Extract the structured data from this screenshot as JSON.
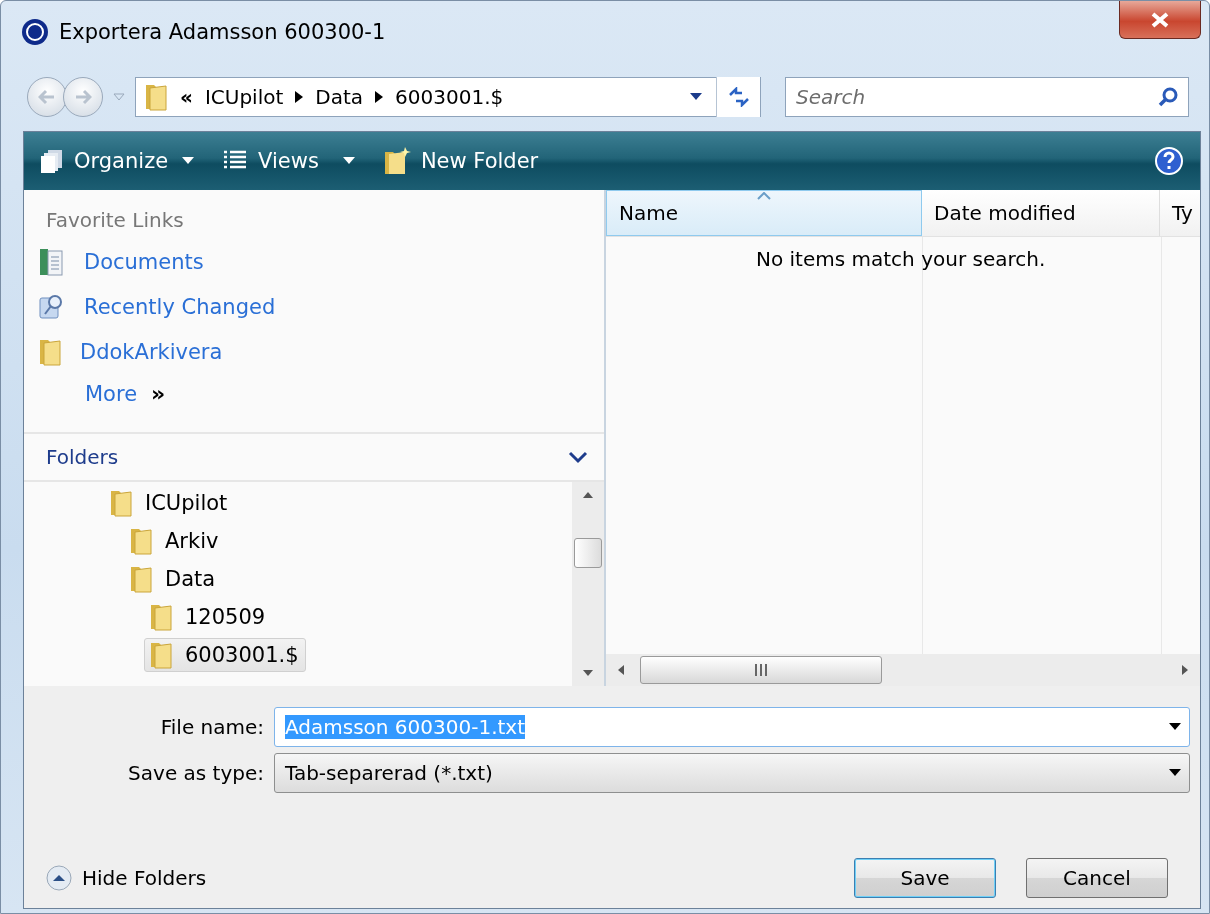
{
  "window": {
    "title": "Exportera Adamsson 600300-1"
  },
  "address": {
    "overflow": "«",
    "crumbs": [
      "ICUpilot",
      "Data",
      "6003001.$"
    ]
  },
  "search": {
    "placeholder": "Search"
  },
  "toolbar": [
    {
      "label": "Organize",
      "kind": "menu"
    },
    {
      "label": "Views",
      "kind": "menu"
    },
    {
      "label": "New Folder",
      "kind": "button"
    }
  ],
  "favorites": {
    "title": "Favorite Links",
    "items": [
      {
        "label": "Documents",
        "kind": "documents"
      },
      {
        "label": "Recently Changed",
        "kind": "recent"
      },
      {
        "label": "DdokArkivera",
        "kind": "folder"
      }
    ],
    "more": "More",
    "more_glyph": "»"
  },
  "folders": {
    "title": "Folders",
    "expanded": true,
    "tree": [
      {
        "label": "ICUpilot",
        "selected": false,
        "children": [
          {
            "label": "Arkiv",
            "selected": false
          },
          {
            "label": "Data",
            "selected": false,
            "children": [
              {
                "label": "120509",
                "selected": false
              },
              {
                "label": "6003001.$",
                "selected": true
              }
            ]
          }
        ]
      }
    ]
  },
  "columns": [
    {
      "label": "Name",
      "sorted": true
    },
    {
      "label": "Date modified",
      "sorted": false
    },
    {
      "label": "Ty",
      "sorted": false
    }
  ],
  "empty_message": "No items match your search.",
  "file_name": {
    "label": "File name:",
    "value": "Adamsson 600300-1.txt"
  },
  "save_type": {
    "label": "Save as type:",
    "value": "Tab-separerad (*.txt)"
  },
  "hide_folders": "Hide Folders",
  "buttons": [
    {
      "label": "Save",
      "default": true
    },
    {
      "label": "Cancel",
      "default": false
    }
  ]
}
